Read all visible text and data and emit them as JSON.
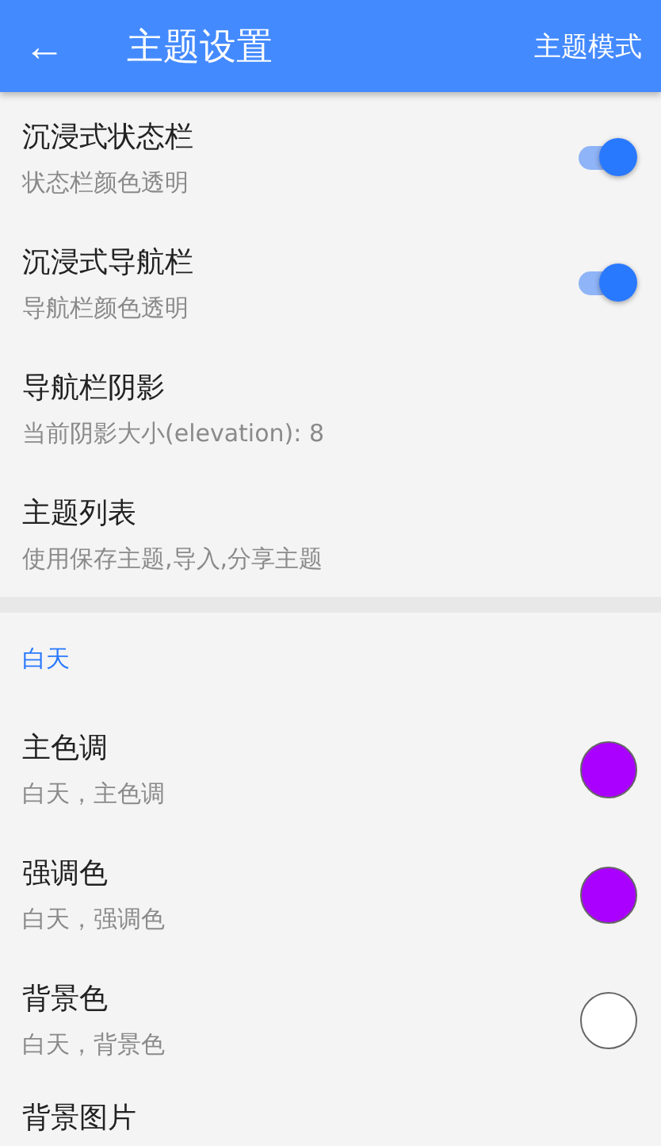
{
  "app_bar": {
    "back_label": "←",
    "title": "主题设置",
    "action": "主题模式"
  },
  "settings": [
    {
      "kind": "switch",
      "title": "沉浸式状态栏",
      "summary": "状态栏颜色透明",
      "on": true
    },
    {
      "kind": "switch",
      "title": "沉浸式导航栏",
      "summary": "导航栏颜色透明",
      "on": true
    },
    {
      "kind": "plain",
      "title": "导航栏阴影",
      "summary": "当前阴影大小(elevation): 8"
    },
    {
      "kind": "plain",
      "title": "主题列表",
      "summary": "使用保存主题,导入,分享主题"
    }
  ],
  "section": {
    "header": "白天",
    "items": [
      {
        "kind": "color",
        "title": "主色调",
        "summary": "白天，主色调",
        "color": "#aa00ff"
      },
      {
        "kind": "color",
        "title": "强调色",
        "summary": "白天，强调色",
        "color": "#aa00ff"
      },
      {
        "kind": "color",
        "title": "背景色",
        "summary": "白天，背景色",
        "color": "#ffffff"
      },
      {
        "kind": "plain",
        "title": "背景图片"
      }
    ]
  }
}
